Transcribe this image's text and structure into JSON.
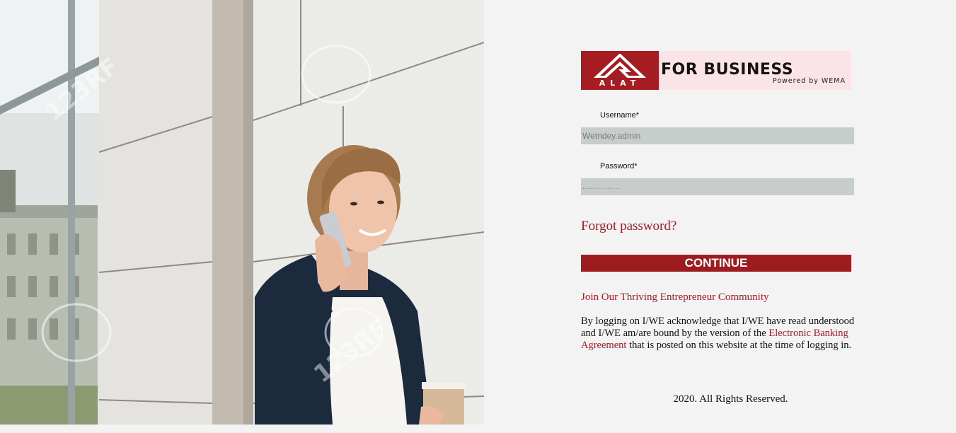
{
  "logo": {
    "mark_text": "ALAT",
    "title": "FOR BUSINESS",
    "subtitle": "Powered by WEMA"
  },
  "form": {
    "username_label": "Username*",
    "username_value": "Wetndey.admin",
    "password_label": "Password*",
    "password_value": "...............",
    "forgot_label": "Forgot password?",
    "continue_label": "CONTINUE"
  },
  "community_link": "Join Our Thriving Entrepreneur Community",
  "acknowledgement": {
    "before": "By logging on I/WE acknowledge that I/WE have read understood and I/WE am/are bound by the version of the ",
    "link": "Electronic Banking Agreement",
    "after": " that is posted on this website at the time of logging in."
  },
  "footer": "2020. All Rights Reserved.",
  "photo": {
    "watermark": "123RF"
  },
  "colors": {
    "brand_red": "#a51c22",
    "button_red": "#9e1c20",
    "field_bg": "#c7cdca",
    "logo_bg": "#fbe4e8"
  }
}
